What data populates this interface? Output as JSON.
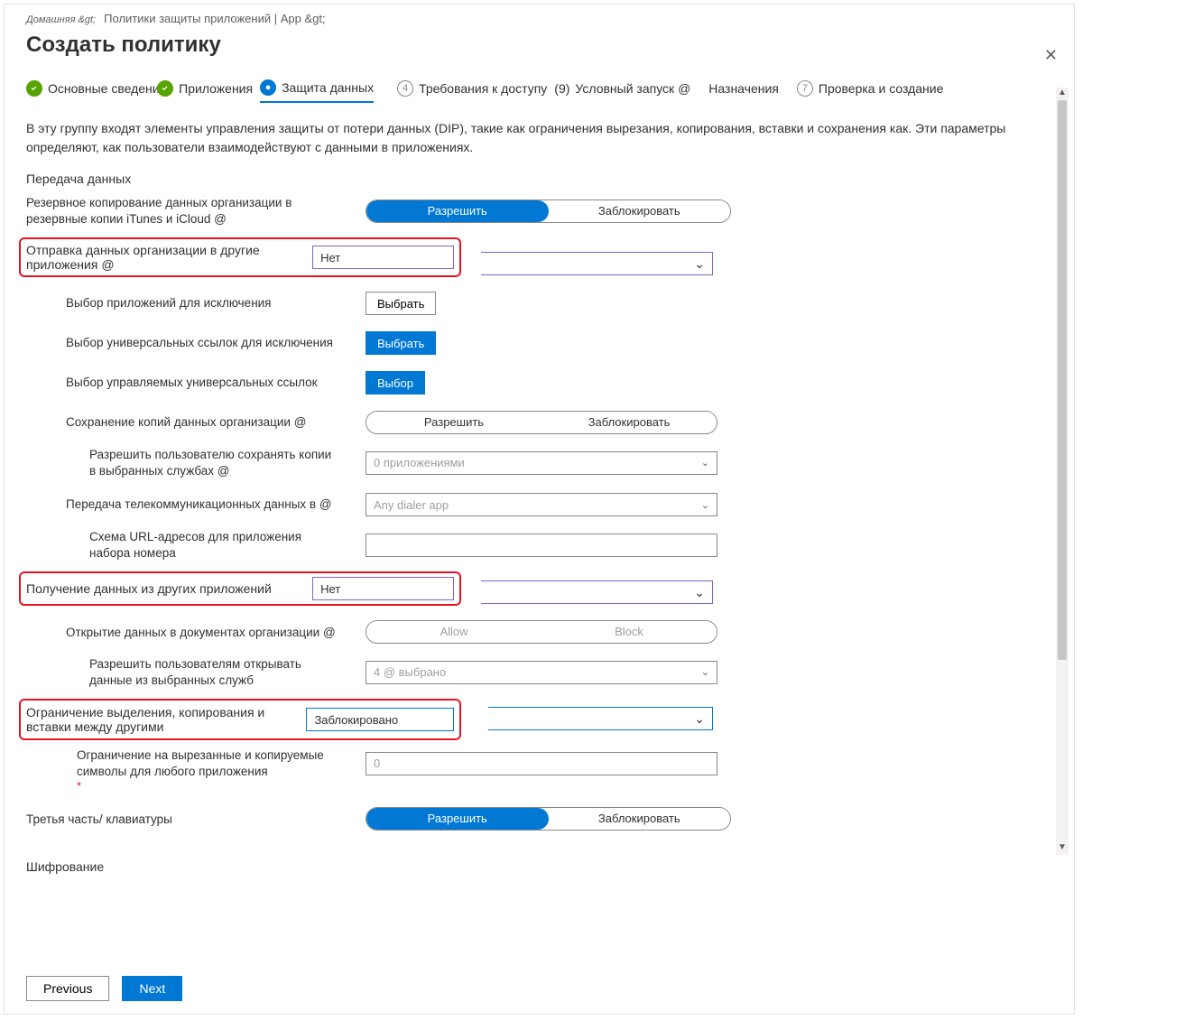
{
  "breadcrumb": {
    "home": "Домашняя &gt;",
    "rest": "Политики защиты приложений | App &gt;"
  },
  "title": "Создать политику",
  "close": "✕",
  "steps": {
    "s1": "Основные сведения",
    "s2": "Приложения",
    "s3": "Защита данных",
    "s4_num": "4",
    "s4": "Требования к доступу",
    "s5_num": "(9)",
    "s5": "Условный запуск @",
    "s6": "Назначения",
    "s7_num": "7",
    "s7": "Проверка и создание"
  },
  "intro": "В эту группу входят элементы управления защиты от потери данных (DIP), такие как ограничения вырезания, копирования, вставки и сохранения как. Эти параметры определяют, как пользователи взаимодействуют с данными в приложениях.",
  "section_transfer": "Передача данных",
  "rows": {
    "backup": {
      "label": "Резервное копирование данных организации в резервные копии iTunes и iCloud @",
      "allow": "Разрешить",
      "block": "Заблокировать"
    },
    "send_other": {
      "label": "Отправка данных организации в другие приложения @",
      "value": "Нет"
    },
    "excl_apps": {
      "label": "Выбор приложений для исключения",
      "btn": "Выбрать"
    },
    "excl_links": {
      "label": "Выбор универсальных ссылок для исключения",
      "btn": "Выбрать"
    },
    "managed_links": {
      "label": "Выбор управляемых универсальных ссылок",
      "btn": "Выбор"
    },
    "save_copies": {
      "label": "Сохранение копий данных организации @",
      "allow": "Разрешить",
      "block": "Заблокировать"
    },
    "allow_save_services": {
      "label": "Разрешить пользователю сохранять копии в выбранных службах @",
      "value": "0 приложениями"
    },
    "telecom": {
      "label": "Передача телекоммуникационных данных в @",
      "value": "Any dialer app"
    },
    "dialer_scheme": {
      "label": "Схема URL-адресов для приложения набора номера",
      "value": ""
    },
    "receive_other": {
      "label": "Получение данных из других приложений",
      "value": "Нет"
    },
    "open_org_docs": {
      "label": "Открытие данных в документах организации @",
      "allow": "Allow",
      "block": "Block"
    },
    "allow_open_services": {
      "label": "Разрешить пользователям открывать данные из выбранных служб",
      "value": "4 @ выбрано"
    },
    "restrict_ccp": {
      "label": "Ограничение выделения, копирования и вставки между другими",
      "value": "Заблокировано"
    },
    "cut_limit": {
      "label": "Ограничение на вырезанные и копируемые символы для любого приложения",
      "value": "0"
    },
    "keyboards": {
      "label": "Третья часть/ клавиатуры",
      "allow": "Разрешить",
      "block": "Заблокировать"
    },
    "encryption": "Шифрование"
  },
  "footer": {
    "prev": "Previous",
    "next": "Next"
  }
}
